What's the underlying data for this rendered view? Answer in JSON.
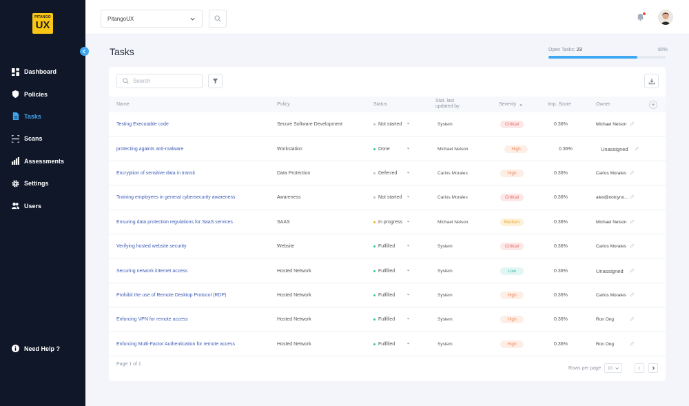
{
  "brand": {
    "logo_small": "PITANGO",
    "logo_big": "UX"
  },
  "sidebar": {
    "items": [
      {
        "label": "Dashboard",
        "icon": "dashboard-icon"
      },
      {
        "label": "Policies",
        "icon": "shield-icon"
      },
      {
        "label": "Tasks",
        "icon": "document-icon",
        "active": true
      },
      {
        "label": "Scans",
        "icon": "scan-icon"
      },
      {
        "label": "Assessments",
        "icon": "bar-chart-icon"
      },
      {
        "label": "Settings",
        "icon": "gear-icon"
      },
      {
        "label": "Users",
        "icon": "users-icon"
      }
    ],
    "help_label": "Need Help ?"
  },
  "topbar": {
    "org_name": "PitangoUX"
  },
  "page": {
    "title": "Tasks",
    "open_tasks_label": "Open Tasks:",
    "open_tasks_count": "23",
    "open_tasks_total": "80",
    "open_tasks_fraction": 0.76
  },
  "toolbar": {
    "search_placeholder": "Search"
  },
  "table": {
    "columns": {
      "name": "Name",
      "policy": "Policy",
      "status": "Status",
      "updated_by_1": "Stat. last",
      "updated_by_2": "updated by",
      "severity": "Severity",
      "score": "Imp. Score",
      "owner": "Owner"
    },
    "rows": [
      {
        "name": "Testing Executable code",
        "policy": "Secure Software Development",
        "status": "Not started",
        "updated_by": "System",
        "severity": "Critical",
        "score": "0.36%",
        "owner": "Michael Nelson"
      },
      {
        "name": "protecting againts anti-malware",
        "policy": "Workstation",
        "status": "Done",
        "updated_by": "Michael Nelson",
        "severity": "High",
        "score": "0.36%",
        "owner": "Unassigned"
      },
      {
        "name": "Encryption of sensitive data in transit",
        "policy": "Data Protection",
        "status": "Deferred",
        "updated_by": "Carlos Morales",
        "severity": "High",
        "score": "0.36%",
        "owner": "Carlos Morales"
      },
      {
        "name": "Training employees in general cybersecurity awareness",
        "policy": "Awareness",
        "status": "Not started",
        "updated_by": "Carlos Morales",
        "severity": "Critical",
        "score": "0.36%",
        "owner": "alex@notcyno..."
      },
      {
        "name": "Ensuring data protection regulations for SaaS services",
        "policy": "SAAS",
        "status": "In progress",
        "updated_by": "Michael Nelson",
        "severity": "Medium",
        "score": "0.36%",
        "owner": "Michael Nelson"
      },
      {
        "name": "Verifying hosted website security",
        "policy": "Website",
        "status": "Fulfilled",
        "updated_by": "System",
        "severity": "Critical",
        "score": "0.36%",
        "owner": "Carlos Morales"
      },
      {
        "name": "Securing network internet access",
        "policy": "Hosted Network",
        "status": "Fulfilled",
        "updated_by": "System",
        "severity": "Low",
        "score": "0.36%",
        "owner": "Unassigned"
      },
      {
        "name": "Prohibit the use of Remote Desktop Protocol (RDP)",
        "policy": "Hosted Network",
        "status": "Fulfilled",
        "updated_by": "System",
        "severity": "High",
        "score": "0.36%",
        "owner": "Carlos Morales"
      },
      {
        "name": "Enforcing VPN for remote access",
        "policy": "Hosted Network",
        "status": "Fulfilled",
        "updated_by": "System",
        "severity": "High",
        "score": "0.36%",
        "owner": "Ron Ong"
      },
      {
        "name": "Enforcing Multi-Factor Authentication for remote access",
        "policy": "Hosted Network",
        "status": "Fulfilled",
        "updated_by": "System",
        "severity": "High",
        "score": "0.36%",
        "owner": "Ron Ong"
      }
    ]
  },
  "pager": {
    "page_text": "Page 1 of 1",
    "rows_per_page_label": "Rows per page",
    "rows_per_page": "10"
  },
  "colors": {
    "accent": "#3fa6f0",
    "sidebar_bg": "#0f1729",
    "status": {
      "Not started": "#b5bcc7",
      "Done": "#2ec4a6",
      "Deferred": "#b5bcc7",
      "In progress": "#f5a623",
      "Fulfilled": "#2ec4a6"
    },
    "severity": {
      "Critical": {
        "bg": "#fde8e8",
        "fg": "#e0625a"
      },
      "High": {
        "bg": "#fdeee6",
        "fg": "#f08a5d"
      },
      "Medium": {
        "bg": "#fdf1d8",
        "fg": "#e8a93a"
      },
      "Low": {
        "bg": "#e2f6f3",
        "fg": "#35b9a0"
      }
    }
  }
}
